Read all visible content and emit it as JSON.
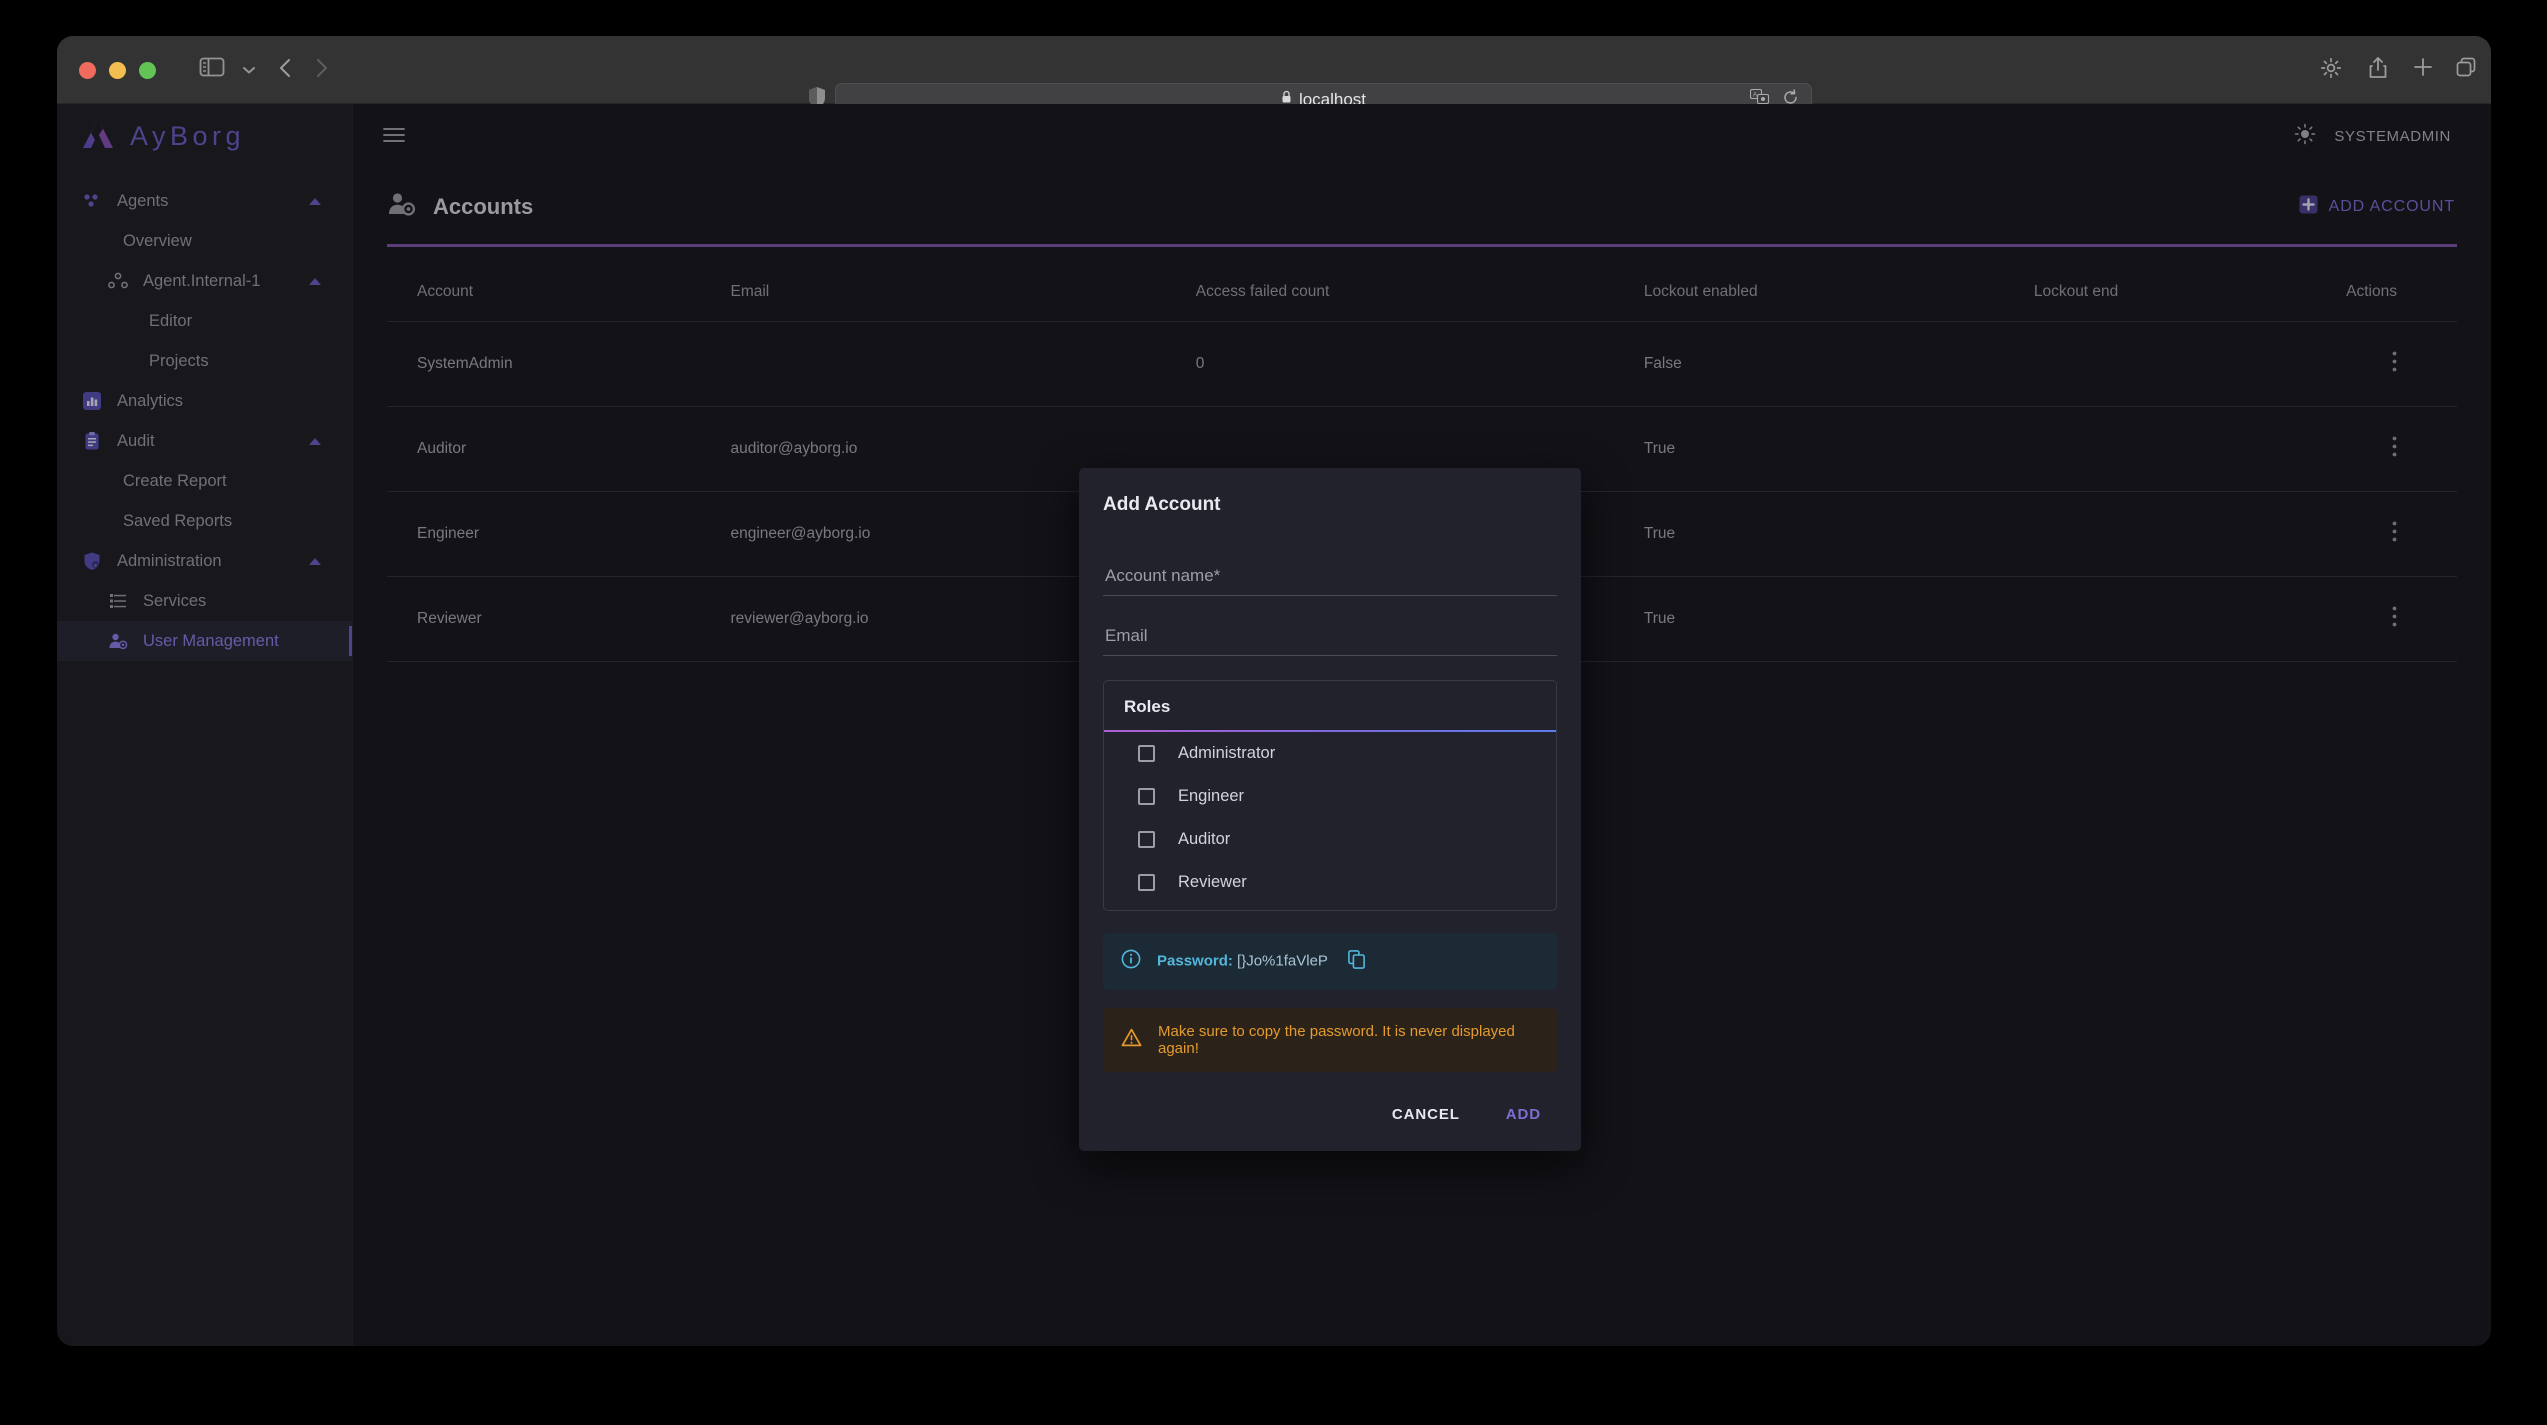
{
  "browser": {
    "url": "localhost",
    "lock_icon": "lock-icon",
    "shield_icon": "shield-icon",
    "sidebar_toggle_icon": "sidebar-toggle-icon",
    "back_icon": "chevron-left-icon",
    "forward_icon": "chevron-right-icon",
    "translate_icon": "translate-icon",
    "reload_icon": "reload-icon",
    "settings_icon": "gear-icon",
    "share_icon": "share-icon",
    "new_tab_icon": "plus-icon",
    "tabs_icon": "tabs-icon"
  },
  "brand": {
    "name": "AyBorg",
    "logo_icon": "ayborg-logo-icon"
  },
  "sidebar": {
    "items": [
      {
        "label": "Agents",
        "level": 0,
        "icon": "agents-icon",
        "expanded": true,
        "active": false
      },
      {
        "label": "Overview",
        "level": 1,
        "icon": "",
        "active": false
      },
      {
        "label": "Agent.Internal-1",
        "level": 1,
        "icon": "agent-node-icon",
        "expanded": true,
        "active": false
      },
      {
        "label": "Editor",
        "level": 2,
        "icon": "",
        "active": false
      },
      {
        "label": "Projects",
        "level": 2,
        "icon": "",
        "active": false
      },
      {
        "label": "Analytics",
        "level": 0,
        "icon": "analytics-icon",
        "active": false
      },
      {
        "label": "Audit",
        "level": 0,
        "icon": "audit-icon",
        "expanded": true,
        "active": false
      },
      {
        "label": "Create Report",
        "level": 1,
        "icon": "",
        "active": false
      },
      {
        "label": "Saved Reports",
        "level": 1,
        "icon": "",
        "active": false
      },
      {
        "label": "Administration",
        "level": 0,
        "icon": "shield-admin-icon",
        "expanded": true,
        "active": false
      },
      {
        "label": "Services",
        "level": 1,
        "icon": "services-icon",
        "active": false
      },
      {
        "label": "User Management",
        "level": 1,
        "icon": "user-management-icon",
        "active": true
      }
    ]
  },
  "appbar": {
    "menu_icon": "hamburger-icon",
    "theme_icon": "sun-icon",
    "user": "SYSTEMADMIN"
  },
  "page": {
    "title": "Accounts",
    "title_icon": "account-settings-icon",
    "add_account_label": "ADD ACCOUNT",
    "add_account_icon": "plus-box-icon"
  },
  "table": {
    "columns": [
      "Account",
      "Email",
      "Access failed count",
      "Lockout enabled",
      "Lockout end",
      "Actions"
    ],
    "rows": [
      {
        "account": "SystemAdmin",
        "email": "",
        "access_failed_count": "0",
        "lockout_enabled": "False",
        "lockout_end": "",
        "actions_icon": "kebab-menu-icon"
      },
      {
        "account": "Auditor",
        "email": "auditor@ayborg.io",
        "access_failed_count": "",
        "lockout_enabled": "True",
        "lockout_end": "",
        "actions_icon": "kebab-menu-icon"
      },
      {
        "account": "Engineer",
        "email": "engineer@ayborg.io",
        "access_failed_count": "",
        "lockout_enabled": "True",
        "lockout_end": "",
        "actions_icon": "kebab-menu-icon"
      },
      {
        "account": "Reviewer",
        "email": "reviewer@ayborg.io",
        "access_failed_count": "",
        "lockout_enabled": "True",
        "lockout_end": "",
        "actions_icon": "kebab-menu-icon"
      }
    ]
  },
  "dialog": {
    "title": "Add Account",
    "account_name_placeholder": "Account name*",
    "account_name_value": "",
    "email_placeholder": "Email",
    "email_value": "",
    "roles_title": "Roles",
    "roles": [
      {
        "label": "Administrator",
        "checked": false
      },
      {
        "label": "Engineer",
        "checked": false
      },
      {
        "label": "Auditor",
        "checked": false
      },
      {
        "label": "Reviewer",
        "checked": false
      }
    ],
    "password_label": "Password:",
    "password_value": "[}Jo%1faVleP",
    "password_info_icon": "info-icon",
    "copy_icon": "copy-icon",
    "warning_icon": "warning-triangle-icon",
    "warning_text": "Make sure to copy the password. It is never displayed again!",
    "cancel_label": "CANCEL",
    "add_label": "ADD"
  },
  "colors": {
    "accent_purple": "#7b6fd4",
    "divider_purple": "#7e57a8",
    "info_blue": "#53b6db",
    "warning_amber": "#e59a2e"
  }
}
